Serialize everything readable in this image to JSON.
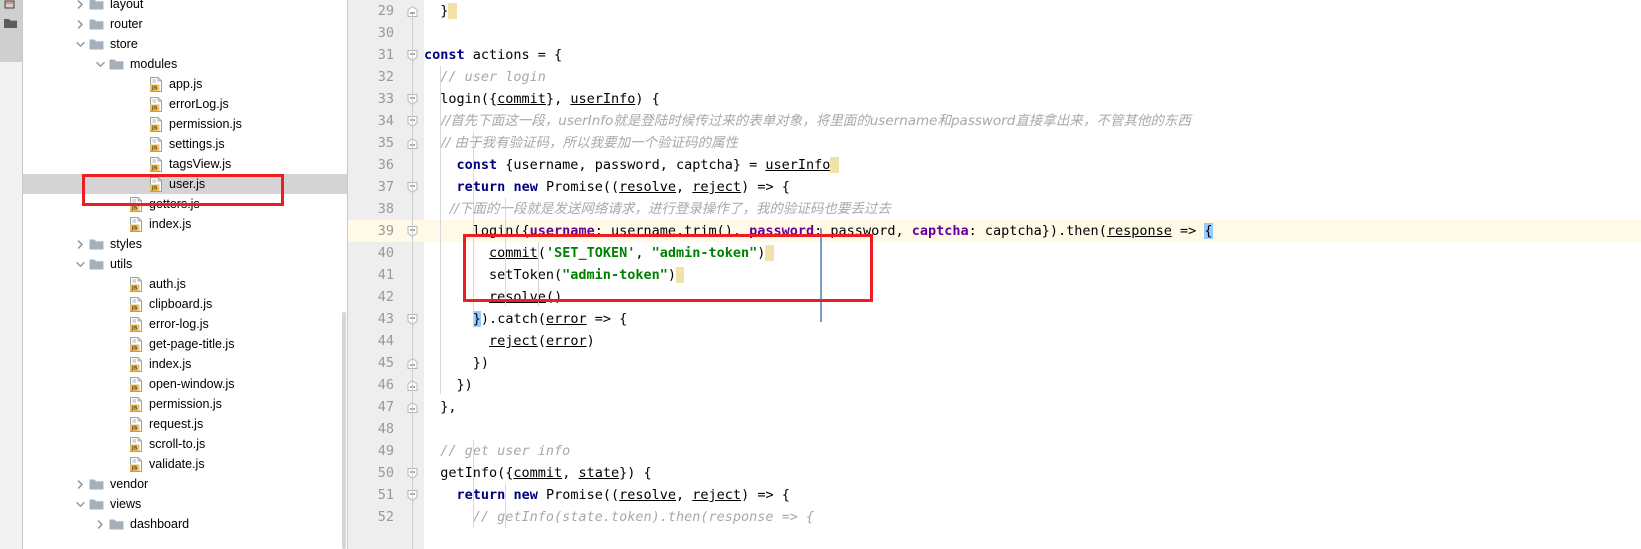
{
  "window": {
    "title": "user.js",
    "accent_red": "#ee1d23",
    "selection_gray": "#d4d4d4",
    "current_line_yellow": "#fffae8"
  },
  "toolstrip": {
    "items": [
      {
        "name": "collapse-all-icon",
        "label": ""
      },
      {
        "name": "project-folder-icon",
        "label": ""
      }
    ]
  },
  "tree": {
    "scrollbar_label": "",
    "items": [
      {
        "label": "layout",
        "type": "folder",
        "indent": 2,
        "arrow": "right",
        "selected": false
      },
      {
        "label": "router",
        "type": "folder",
        "indent": 2,
        "arrow": "right",
        "selected": false
      },
      {
        "label": "store",
        "type": "folder",
        "indent": 2,
        "arrow": "down",
        "selected": false
      },
      {
        "label": "modules",
        "type": "folder",
        "indent": 3,
        "arrow": "down",
        "selected": false
      },
      {
        "label": "app.js",
        "type": "js",
        "indent": 5,
        "arrow": "none",
        "selected": false
      },
      {
        "label": "errorLog.js",
        "type": "js",
        "indent": 5,
        "arrow": "none",
        "selected": false
      },
      {
        "label": "permission.js",
        "type": "js",
        "indent": 5,
        "arrow": "none",
        "selected": false
      },
      {
        "label": "settings.js",
        "type": "js",
        "indent": 5,
        "arrow": "none",
        "selected": false
      },
      {
        "label": "tagsView.js",
        "type": "js",
        "indent": 5,
        "arrow": "none",
        "selected": false
      },
      {
        "label": "user.js",
        "type": "js",
        "indent": 5,
        "arrow": "none",
        "selected": true
      },
      {
        "label": "getters.js",
        "type": "js",
        "indent": 4,
        "arrow": "none",
        "selected": false
      },
      {
        "label": "index.js",
        "type": "js",
        "indent": 4,
        "arrow": "none",
        "selected": false
      },
      {
        "label": "styles",
        "type": "folder",
        "indent": 2,
        "arrow": "right",
        "selected": false
      },
      {
        "label": "utils",
        "type": "folder",
        "indent": 2,
        "arrow": "down",
        "selected": false
      },
      {
        "label": "auth.js",
        "type": "js",
        "indent": 4,
        "arrow": "none",
        "selected": false
      },
      {
        "label": "clipboard.js",
        "type": "js",
        "indent": 4,
        "arrow": "none",
        "selected": false
      },
      {
        "label": "error-log.js",
        "type": "js",
        "indent": 4,
        "arrow": "none",
        "selected": false
      },
      {
        "label": "get-page-title.js",
        "type": "js",
        "indent": 4,
        "arrow": "none",
        "selected": false
      },
      {
        "label": "index.js",
        "type": "js",
        "indent": 4,
        "arrow": "none",
        "selected": false
      },
      {
        "label": "open-window.js",
        "type": "js",
        "indent": 4,
        "arrow": "none",
        "selected": false
      },
      {
        "label": "permission.js",
        "type": "js",
        "indent": 4,
        "arrow": "none",
        "selected": false
      },
      {
        "label": "request.js",
        "type": "js",
        "indent": 4,
        "arrow": "none",
        "selected": false
      },
      {
        "label": "scroll-to.js",
        "type": "js",
        "indent": 4,
        "arrow": "none",
        "selected": false
      },
      {
        "label": "validate.js",
        "type": "js",
        "indent": 4,
        "arrow": "none",
        "selected": false
      },
      {
        "label": "vendor",
        "type": "folder",
        "indent": 2,
        "arrow": "right",
        "selected": false
      },
      {
        "label": "views",
        "type": "folder",
        "indent": 2,
        "arrow": "down",
        "selected": false
      },
      {
        "label": "dashboard",
        "type": "folder",
        "indent": 3,
        "arrow": "right",
        "selected": false
      }
    ]
  },
  "editor": {
    "first_line_number": 29,
    "current_line_number": 39,
    "lines": [
      {
        "n": 29,
        "fold": "collapse-end",
        "indent_levels": 0,
        "tokens": [
          {
            "t": "  ",
            "c": "plain"
          },
          {
            "t": "}",
            "c": "plain"
          },
          {
            "t": " ",
            "c": "hl-end"
          }
        ]
      },
      {
        "n": 30,
        "fold": "none",
        "indent_levels": 0,
        "tokens": []
      },
      {
        "n": 31,
        "fold": "collapse",
        "indent_levels": 0,
        "tokens": [
          {
            "t": "const",
            "c": "kw"
          },
          {
            "t": " actions = {",
            "c": "plain"
          }
        ]
      },
      {
        "n": 32,
        "fold": "none",
        "indent_levels": 1,
        "tokens": [
          {
            "t": "  // user login",
            "c": "cmt"
          }
        ]
      },
      {
        "n": 33,
        "fold": "collapse",
        "indent_levels": 1,
        "tokens": [
          {
            "t": "  login({",
            "c": "plain"
          },
          {
            "t": "commit",
            "c": "link"
          },
          {
            "t": "}, ",
            "c": "plain"
          },
          {
            "t": "userInfo",
            "c": "link"
          },
          {
            "t": ") {",
            "c": "plain"
          }
        ]
      },
      {
        "n": 34,
        "fold": "collapse",
        "indent_levels": 2,
        "tokens": [
          {
            "t": "    //首先下面这一段，userInfo就是登陆时候传过来的表单对象，将里面的username和password直接拿出来，不管其他的东西",
            "c": "cmt-cn"
          }
        ]
      },
      {
        "n": 35,
        "fold": "collapse-end",
        "indent_levels": 2,
        "tokens": [
          {
            "t": "    // 由于我有验证码，所以我要加一个验证码的属性",
            "c": "cmt-cn"
          }
        ]
      },
      {
        "n": 36,
        "fold": "none",
        "indent_levels": 2,
        "tokens": [
          {
            "t": "    ",
            "c": "plain"
          },
          {
            "t": "const",
            "c": "kw"
          },
          {
            "t": " {username, password, captcha} = ",
            "c": "plain"
          },
          {
            "t": "userInfo",
            "c": "link"
          },
          {
            "t": " ",
            "c": "hl-end"
          }
        ]
      },
      {
        "n": 37,
        "fold": "collapse",
        "indent_levels": 2,
        "tokens": [
          {
            "t": "    ",
            "c": "plain"
          },
          {
            "t": "return",
            "c": "kw"
          },
          {
            "t": " ",
            "c": "plain"
          },
          {
            "t": "new",
            "c": "kw"
          },
          {
            "t": " Promise((",
            "c": "plain"
          },
          {
            "t": "resolve",
            "c": "link"
          },
          {
            "t": ", ",
            "c": "plain"
          },
          {
            "t": "reject",
            "c": "link"
          },
          {
            "t": ") => {",
            "c": "plain"
          }
        ]
      },
      {
        "n": 38,
        "fold": "none",
        "indent_levels": 3,
        "tokens": [
          {
            "t": "      //下面的一段就是发送网络请求，进行登录操作了，我的验证码也要丢过去",
            "c": "cmt-cn"
          }
        ]
      },
      {
        "n": 39,
        "fold": "collapse",
        "indent_levels": 3,
        "current": true,
        "tokens": [
          {
            "t": "      login({",
            "c": "plain"
          },
          {
            "t": "username",
            "c": "prop"
          },
          {
            "t": ": username.",
            "c": "plain"
          },
          {
            "t": "trim",
            "c": "link"
          },
          {
            "t": "(), ",
            "c": "plain"
          },
          {
            "t": "password",
            "c": "prop"
          },
          {
            "t": ": password, ",
            "c": "plain"
          },
          {
            "t": "captcha",
            "c": "prop"
          },
          {
            "t": ": captcha}).",
            "c": "plain"
          },
          {
            "t": "then",
            "c": "plain"
          },
          {
            "t": "(",
            "c": "plain"
          },
          {
            "t": "response",
            "c": "link"
          },
          {
            "t": " => ",
            "c": "plain"
          },
          {
            "t": "{",
            "c": "bmatch"
          }
        ]
      },
      {
        "n": 40,
        "fold": "none",
        "indent_levels": 4,
        "tokens": [
          {
            "t": "        ",
            "c": "plain"
          },
          {
            "t": "commit",
            "c": "link"
          },
          {
            "t": "(",
            "c": "plain"
          },
          {
            "t": "'SET_TOKEN'",
            "c": "str"
          },
          {
            "t": ", ",
            "c": "plain"
          },
          {
            "t": "\"admin-token\"",
            "c": "str"
          },
          {
            "t": ")",
            "c": "plain"
          },
          {
            "t": " ",
            "c": "hl-end"
          }
        ]
      },
      {
        "n": 41,
        "fold": "none",
        "indent_levels": 4,
        "tokens": [
          {
            "t": "        setToken(",
            "c": "plain"
          },
          {
            "t": "\"admin-token\"",
            "c": "str"
          },
          {
            "t": ")",
            "c": "plain"
          },
          {
            "t": " ",
            "c": "hl-end"
          }
        ]
      },
      {
        "n": 42,
        "fold": "none",
        "indent_levels": 4,
        "tokens": [
          {
            "t": "        ",
            "c": "plain"
          },
          {
            "t": "resolve",
            "c": "link"
          },
          {
            "t": "()",
            "c": "plain"
          }
        ]
      },
      {
        "n": 43,
        "fold": "collapse",
        "indent_levels": 3,
        "tokens": [
          {
            "t": "      ",
            "c": "plain"
          },
          {
            "t": "}",
            "c": "bmatch"
          },
          {
            "t": ").",
            "c": "plain"
          },
          {
            "t": "catch",
            "c": "plain"
          },
          {
            "t": "(",
            "c": "plain"
          },
          {
            "t": "error",
            "c": "link"
          },
          {
            "t": " => {",
            "c": "plain"
          }
        ]
      },
      {
        "n": 44,
        "fold": "none",
        "indent_levels": 4,
        "tokens": [
          {
            "t": "        ",
            "c": "plain"
          },
          {
            "t": "reject",
            "c": "link"
          },
          {
            "t": "(",
            "c": "plain"
          },
          {
            "t": "error",
            "c": "link"
          },
          {
            "t": ")",
            "c": "plain"
          }
        ]
      },
      {
        "n": 45,
        "fold": "collapse-end",
        "indent_levels": 3,
        "tokens": [
          {
            "t": "      })",
            "c": "plain"
          }
        ]
      },
      {
        "n": 46,
        "fold": "collapse-end",
        "indent_levels": 2,
        "tokens": [
          {
            "t": "    })",
            "c": "plain"
          }
        ]
      },
      {
        "n": 47,
        "fold": "collapse-end",
        "indent_levels": 1,
        "tokens": [
          {
            "t": "  },",
            "c": "plain"
          }
        ]
      },
      {
        "n": 48,
        "fold": "none",
        "indent_levels": 0,
        "tokens": []
      },
      {
        "n": 49,
        "fold": "none",
        "indent_levels": 1,
        "tokens": [
          {
            "t": "  // get user info",
            "c": "cmt"
          }
        ]
      },
      {
        "n": 50,
        "fold": "collapse",
        "indent_levels": 1,
        "tokens": [
          {
            "t": "  getInfo({",
            "c": "plain"
          },
          {
            "t": "commit",
            "c": "link"
          },
          {
            "t": ", ",
            "c": "plain"
          },
          {
            "t": "state",
            "c": "link"
          },
          {
            "t": "}) {",
            "c": "plain"
          }
        ]
      },
      {
        "n": 51,
        "fold": "collapse",
        "indent_levels": 2,
        "tokens": [
          {
            "t": "    ",
            "c": "plain"
          },
          {
            "t": "return",
            "c": "kw"
          },
          {
            "t": " ",
            "c": "plain"
          },
          {
            "t": "new",
            "c": "kw"
          },
          {
            "t": " Promise((",
            "c": "plain"
          },
          {
            "t": "resolve",
            "c": "link"
          },
          {
            "t": ", ",
            "c": "plain"
          },
          {
            "t": "reject",
            "c": "link"
          },
          {
            "t": ") => {",
            "c": "plain"
          }
        ]
      },
      {
        "n": 52,
        "fold": "none",
        "indent_levels": 3,
        "tokens": [
          {
            "t": "      // getInfo(state.token).then(response => {",
            "c": "cmt"
          }
        ]
      }
    ]
  },
  "annotations": {
    "tree_highlight_target": "user.js",
    "code_highlight_lines": "40-42"
  }
}
